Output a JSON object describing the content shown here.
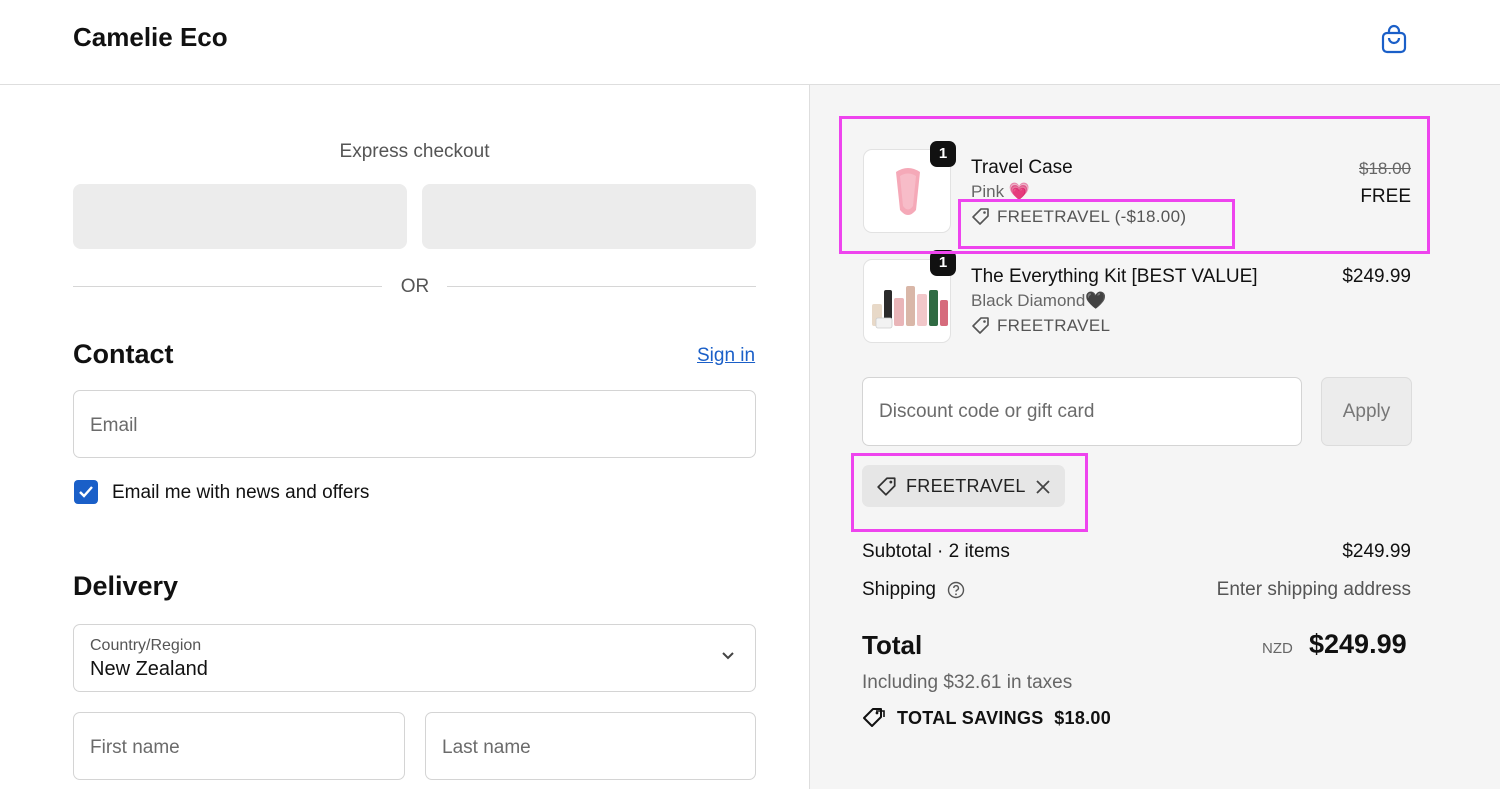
{
  "header": {
    "brand": "Camelie Eco",
    "cart_icon": "shopping-bag-icon"
  },
  "express": {
    "title": "Express checkout",
    "divider": "OR"
  },
  "contact": {
    "heading": "Contact",
    "sign_in": "Sign in",
    "email_placeholder": "Email",
    "newsletter_label": "Email me with news and offers",
    "newsletter_checked": true
  },
  "delivery": {
    "heading": "Delivery",
    "country_label": "Country/Region",
    "country_value": "New Zealand",
    "first_name_placeholder": "First name",
    "last_name_placeholder": "Last name"
  },
  "order": {
    "items": [
      {
        "qty": "1",
        "name": "Travel Case",
        "variant": "Pink 💗",
        "discount": "FREETRAVEL (-$18.00)",
        "original_price": "$18.00",
        "price": "FREE"
      },
      {
        "qty": "1",
        "name": "The Everything Kit [BEST VALUE]",
        "variant": "Black Diamond🖤",
        "discount": "FREETRAVEL",
        "price": "$249.99"
      }
    ],
    "discount_placeholder": "Discount code or gift card",
    "apply_label": "Apply",
    "applied_code": "FREETRAVEL",
    "subtotal_label": "Subtotal · 2 items",
    "subtotal_value": "$249.99",
    "shipping_label": "Shipping",
    "shipping_value": "Enter shipping address",
    "total_label": "Total",
    "currency": "NZD",
    "total_value": "$249.99",
    "taxes_note": "Including $32.61 in taxes",
    "savings_label": "TOTAL SAVINGS",
    "savings_value": "$18.00"
  },
  "colors": {
    "accent": "#1a5fc8",
    "highlight": "#ee44ee",
    "summary_bg": "#f5f5f5"
  }
}
